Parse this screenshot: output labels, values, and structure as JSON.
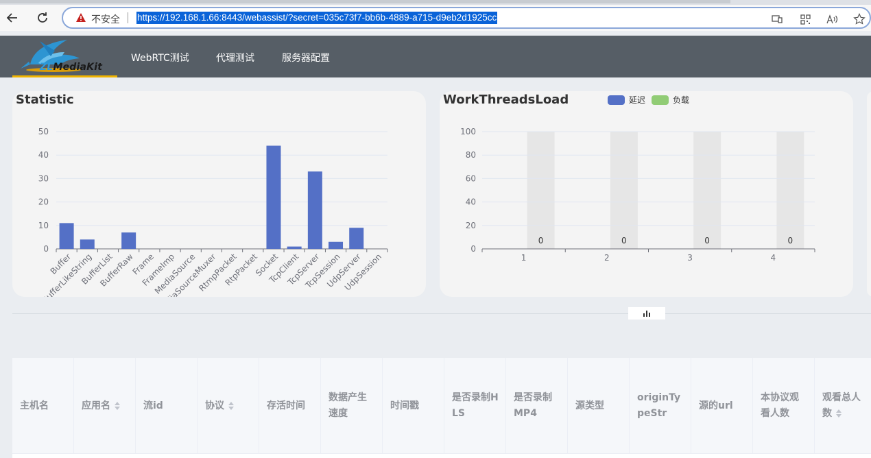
{
  "browser": {
    "insecure_label": "不安全",
    "url": "https://192.168.1.66:8443/webassist/?secret=035c73f7-bb6b-4889-a715-d9eb2d1925cc"
  },
  "header": {
    "logo_text_a": "ZL",
    "logo_text_b": "MediaKit",
    "menu": [
      "WebRTC测试",
      "代理测试",
      "服务器配置"
    ]
  },
  "statistic": {
    "title": "Statistic",
    "chart_data": {
      "type": "bar",
      "categories": [
        "Buffer",
        "BufferLikeString",
        "BufferList",
        "BufferRaw",
        "Frame",
        "FrameImp",
        "MediaSource",
        "MediaSourceMuxer",
        "RtmpPacket",
        "RtpPacket",
        "Socket",
        "TcpClient",
        "TcpServer",
        "TcpSession",
        "UdpServer",
        "UdpSession"
      ],
      "values": [
        11,
        4,
        0,
        7,
        0,
        0,
        0,
        0,
        0,
        0,
        44,
        1,
        33,
        3,
        9,
        0
      ],
      "yticks": [
        0,
        10,
        20,
        30,
        40,
        50
      ],
      "ylim": [
        0,
        50
      ],
      "color": "#5470c6"
    }
  },
  "workload": {
    "title": "WorkThreadsLoad",
    "legend": [
      {
        "name": "延迟",
        "color": "#5470c6"
      },
      {
        "name": "负载",
        "color": "#91cc75"
      }
    ],
    "chart_data": {
      "type": "bar",
      "categories": [
        "1",
        "2",
        "3",
        "4"
      ],
      "series": [
        {
          "name": "延迟",
          "values": [
            0,
            0,
            0,
            0
          ]
        },
        {
          "name": "负载",
          "values": [
            0,
            0,
            0,
            0
          ]
        }
      ],
      "labels": [
        "0",
        "0",
        "0",
        "0"
      ],
      "yticks": [
        0,
        20,
        40,
        60,
        80,
        100
      ],
      "ylim": [
        0,
        100
      ]
    }
  },
  "table": {
    "columns": [
      {
        "label": "主机名",
        "sortable": false
      },
      {
        "label": "应用名",
        "sortable": true
      },
      {
        "label": "流id",
        "sortable": false
      },
      {
        "label": "协议",
        "sortable": true
      },
      {
        "label": "存活时间",
        "sortable": false
      },
      {
        "label": "数据产生速度",
        "sortable": false
      },
      {
        "label": "时间戳",
        "sortable": false
      },
      {
        "label": "是否录制HLS",
        "sortable": false
      },
      {
        "label": "是否录制MP4",
        "sortable": false
      },
      {
        "label": "源类型",
        "sortable": false
      },
      {
        "label": "originTypeStr",
        "sortable": false
      },
      {
        "label": "源的url",
        "sortable": false
      },
      {
        "label": "本协议观看人数",
        "sortable": false
      },
      {
        "label": "观看总人数",
        "sortable": true
      }
    ]
  }
}
